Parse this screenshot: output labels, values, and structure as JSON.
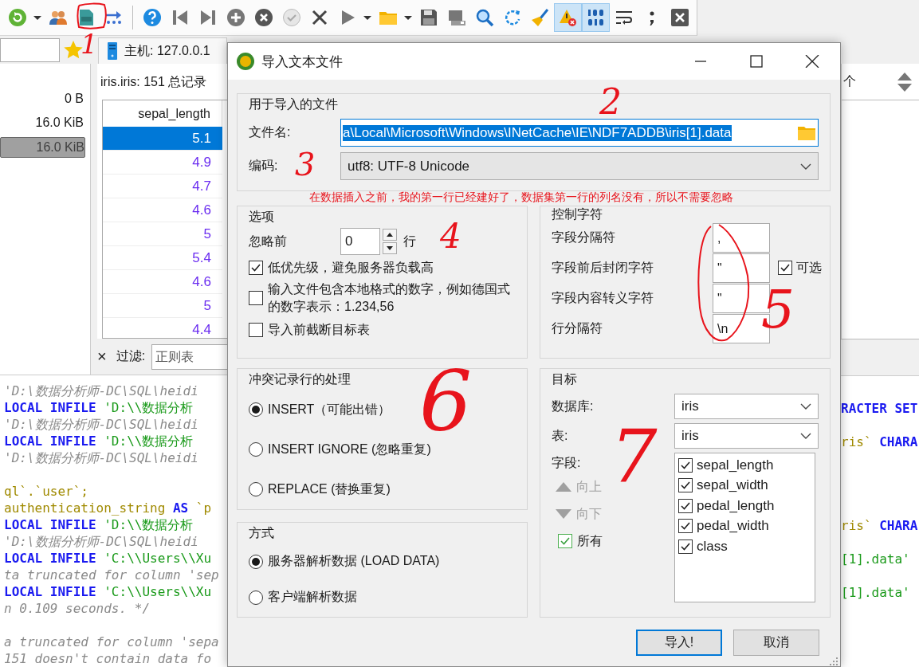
{
  "toolbar": [
    {
      "selected": false
    },
    {
      "selected": false
    },
    {
      "selected": false
    },
    {
      "selected": false
    },
    {
      "selected": false
    },
    {
      "selected": false
    },
    {
      "selected": false
    },
    {
      "selected": false
    },
    {
      "selected": false
    },
    {
      "selected": false
    },
    {
      "selected": false
    },
    {
      "selected": false
    },
    {
      "selected": false
    },
    {
      "selected": false
    },
    {
      "selected": false
    },
    {
      "selected": false
    },
    {
      "selected": false
    },
    {
      "selected": false
    },
    {
      "selected": false
    },
    {
      "selected": false
    },
    {
      "selected": false
    },
    {
      "selected": true
    },
    {
      "selected": true
    },
    {
      "selected": false
    },
    {
      "selected": false
    },
    {
      "selected": false
    }
  ],
  "host_tab": {
    "label": "主机: 127.0.0.1"
  },
  "sizes": [
    {
      "text": "0 B",
      "selected": false
    },
    {
      "text": "16.0 KiB",
      "selected": false
    },
    {
      "text": "16.0 KiB",
      "selected": true
    }
  ],
  "grid": {
    "caption": "iris.iris: 151 总记录",
    "columns": [
      "sepal_length"
    ],
    "rows": [
      {
        "cells": [
          "5.1"
        ],
        "selected": true
      },
      {
        "cells": [
          "4.9"
        ],
        "selected": false
      },
      {
        "cells": [
          "4.7"
        ],
        "selected": false
      },
      {
        "cells": [
          "4.6"
        ],
        "selected": false
      },
      {
        "cells": [
          "5"
        ],
        "selected": false
      },
      {
        "cells": [
          "5.4"
        ],
        "selected": false
      },
      {
        "cells": [
          "4.6"
        ],
        "selected": false
      },
      {
        "cells": [
          "5"
        ],
        "selected": false
      },
      {
        "cells": [
          "4.4"
        ],
        "selected": false
      }
    ]
  },
  "filter": {
    "close": "×",
    "label": "过滤:",
    "placeholder": "正则表"
  },
  "right_header": {
    "text": "个"
  },
  "log_blocks": [
    {
      "lines": [
        {
          "left": [
            {
              "kind": "comment",
              "text": "'D:\\数据分析师-DC\\SQL\\heidi"
            }
          ]
        },
        {
          "left": [
            {
              "kind": "keyword",
              "text": "LOCAL INFILE"
            },
            {
              "kind": "string",
              "text": "'D:\\\\数据分析"
            }
          ],
          "right": [
            {
              "kind": "keyword",
              "text": "RACTER SET"
            }
          ]
        },
        {
          "left": [
            {
              "kind": "comment",
              "text": "'D:\\数据分析师-DC\\SQL\\heidi"
            }
          ]
        },
        {
          "left": [
            {
              "kind": "keyword",
              "text": "LOCAL INFILE"
            },
            {
              "kind": "string",
              "text": "'D:\\\\数据分析"
            }
          ],
          "right": [
            {
              "kind": "ident",
              "text": "ris`"
            },
            {
              "kind": "keyword",
              "text": "CHARA"
            }
          ]
        },
        {
          "left": [
            {
              "kind": "comment",
              "text": "'D:\\数据分析师-DC\\SQL\\heidi"
            }
          ]
        }
      ]
    },
    {
      "lines": [
        {
          "left": [
            {
              "kind": "ident",
              "text": "ql`.`user`;"
            }
          ]
        },
        {
          "left": [
            {
              "kind": "ident",
              "text": "authentication_string"
            },
            {
              "kind": "keyword",
              "text": "AS"
            },
            {
              "kind": "ident",
              "text": "`p"
            }
          ]
        },
        {
          "left": [
            {
              "kind": "keyword",
              "text": "LOCAL INFILE"
            },
            {
              "kind": "string",
              "text": "'D:\\\\数据分析"
            }
          ],
          "right": [
            {
              "kind": "ident",
              "text": "ris`"
            },
            {
              "kind": "keyword",
              "text": "CHARA"
            }
          ]
        },
        {
          "left": [
            {
              "kind": "comment",
              "text": "'D:\\数据分析师-DC\\SQL\\heidi"
            }
          ]
        },
        {
          "left": [
            {
              "kind": "keyword",
              "text": "LOCAL INFILE"
            },
            {
              "kind": "string",
              "text": "'C:\\\\Users\\\\Xu"
            }
          ],
          "right": [
            {
              "kind": "string",
              "text": "[1].data'"
            }
          ]
        },
        {
          "left": [
            {
              "kind": "comment",
              "text": "ta truncated for column 'sep"
            }
          ]
        },
        {
          "left": [
            {
              "kind": "keyword",
              "text": "LOCAL INFILE"
            },
            {
              "kind": "string",
              "text": "'C:\\\\Users\\\\Xu"
            }
          ],
          "right": [
            {
              "kind": "string",
              "text": "[1].data'"
            }
          ]
        },
        {
          "left": [
            {
              "kind": "comment",
              "text": "n 0.109 seconds. */"
            }
          ]
        }
      ]
    },
    {
      "lines": [
        {
          "left": [
            {
              "kind": "comment",
              "text": "a truncated for column 'sepa"
            }
          ]
        },
        {
          "left": [
            {
              "kind": "comment",
              "text": "151 doesn't contain data fo"
            }
          ]
        }
      ]
    }
  ],
  "dialog": {
    "title": "导入文本文件",
    "file_group": {
      "title": "用于导入的文件",
      "filename_label": "文件名:",
      "filename": {
        "value": "a\\Local\\Microsoft\\Windows\\INetCache\\IE\\NDF7ADDB\\iris[1].data",
        "selected": true
      },
      "encoding_label": "编码:",
      "encoding": "utf8: UTF-8 Unicode"
    },
    "options": {
      "title": "选项",
      "ignore_label": "忽略前",
      "ignore_value": "0",
      "ignore_unit": "行",
      "checkboxes": [
        {
          "label": "低优先级，避免服务器负载高",
          "checked": true
        },
        {
          "label": "输入文件包含本地格式的数字，例如德国式的数字表示：1.234,56",
          "checked": false
        },
        {
          "label": "导入前截断目标表",
          "checked": false
        }
      ]
    },
    "control_chars": {
      "title": "控制字符",
      "rows": [
        {
          "label": "字段分隔符",
          "value": ","
        },
        {
          "label": "字段前后封闭字符",
          "value": "\"",
          "option": {
            "label": "可选",
            "checked": true
          }
        },
        {
          "label": "字段内容转义字符",
          "value": "\""
        },
        {
          "label": "行分隔符",
          "value": "\\n"
        }
      ]
    },
    "conflict": {
      "title": "冲突记录行的处理",
      "options": [
        {
          "label": "INSERT（可能出错）",
          "selected": true
        },
        {
          "label": "INSERT IGNORE (忽略重复)",
          "selected": false
        },
        {
          "label": "REPLACE (替换重复)",
          "selected": false
        }
      ]
    },
    "method": {
      "title": "方式",
      "options": [
        {
          "label": "服务器解析数据 (LOAD DATA)",
          "selected": true
        },
        {
          "label": "客户端解析数据",
          "selected": false
        }
      ]
    },
    "target": {
      "title": "目标",
      "database_label": "数据库:",
      "database": "iris",
      "table_label": "表:",
      "table": "iris",
      "fields_label": "字段:",
      "up": {
        "label": "向上",
        "disabled": true
      },
      "down": {
        "label": "向下",
        "disabled": true
      },
      "all": {
        "label": "所有",
        "checked": true
      },
      "fields": [
        {
          "label": "sepal_length",
          "checked": true
        },
        {
          "label": "sepal_width",
          "checked": true
        },
        {
          "label": "pedal_length",
          "checked": true
        },
        {
          "label": "pedal_width",
          "checked": true
        },
        {
          "label": "class",
          "checked": true
        }
      ]
    },
    "buttons": [
      {
        "label": "导入!",
        "default": true
      },
      {
        "label": "取消",
        "default": false
      }
    ]
  },
  "annotations": [
    {
      "kind": "note",
      "text": "在数据插入之前，我的第一行已经建好了，数据集第一行的列名没有，所以不需要忽略"
    },
    {
      "kind": "number",
      "text": "1"
    },
    {
      "kind": "number",
      "text": "2"
    },
    {
      "kind": "number",
      "text": "3"
    },
    {
      "kind": "number",
      "text": "4"
    },
    {
      "kind": "number",
      "text": "5"
    },
    {
      "kind": "number",
      "text": "6"
    },
    {
      "kind": "number",
      "text": "7"
    },
    {
      "kind": "circle"
    },
    {
      "kind": "loop"
    }
  ]
}
